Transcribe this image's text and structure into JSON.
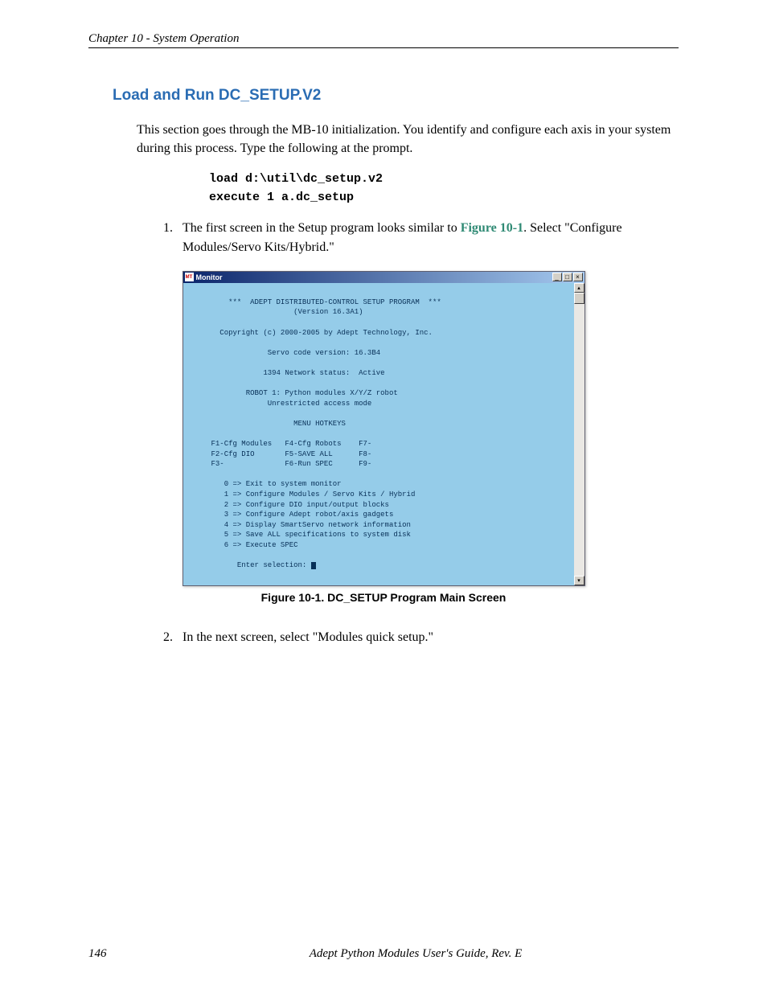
{
  "header": {
    "chapter": "Chapter 10 - System Operation"
  },
  "section": {
    "title": "Load and Run DC_SETUP.V2",
    "intro": "This section goes through the MB-10 initialization. You identify and configure each axis in your system during this process. Type the following at the prompt."
  },
  "code": {
    "line1": "load d:\\util\\dc_setup.v2",
    "line2": "execute 1 a.dc_setup"
  },
  "steps": [
    {
      "num": "1.",
      "pre": "The first screen in the Setup program looks similar to ",
      "figref": "Figure 10-1",
      "post": ". Select \"Configure Modules/Servo Kits/Hybrid.\""
    },
    {
      "num": "2.",
      "text": "In the next screen, select \"Modules quick setup.\""
    }
  ],
  "monitor": {
    "app_icon": "MT",
    "title": "Monitor",
    "minimize": "_",
    "maximize": "□",
    "close": "×",
    "scroll_up": "▴",
    "scroll_down": "▾",
    "lines": {
      "l1": "         ***  ADEPT DISTRIBUTED-CONTROL SETUP PROGRAM  ***",
      "l2": "                        (Version 16.3A1)",
      "l3": "",
      "l4": "       Copyright (c) 2000-2005 by Adept Technology, Inc.",
      "l5": "",
      "l6": "                  Servo code version: 16.3B4",
      "l7": "",
      "l8": "                 1394 Network status:  Active",
      "l9": "",
      "l10": "             ROBOT 1: Python modules X/Y/Z robot",
      "l11": "                  Unrestricted access mode",
      "l12": "",
      "l13": "                        MENU HOTKEYS",
      "l14": "",
      "l15": "     F1-Cfg Modules   F4-Cfg Robots    F7-",
      "l16": "     F2-Cfg DIO       F5-SAVE ALL      F8-",
      "l17": "     F3-              F6-Run SPEC      F9-",
      "l18": "",
      "l19": "        0 => Exit to system monitor",
      "l20": "        1 => Configure Modules / Servo Kits / Hybrid",
      "l21": "        2 => Configure DIO input/output blocks",
      "l22": "        3 => Configure Adept robot/axis gadgets",
      "l23": "        4 => Display SmartServo network information",
      "l24": "        5 => Save ALL specifications to system disk",
      "l25": "        6 => Execute SPEC",
      "l26": "",
      "l27": "           Enter selection: "
    }
  },
  "figure_caption": "Figure 10-1. DC_SETUP Program Main Screen",
  "footer": {
    "page": "146",
    "title": "Adept Python Modules User's Guide, Rev. E"
  }
}
